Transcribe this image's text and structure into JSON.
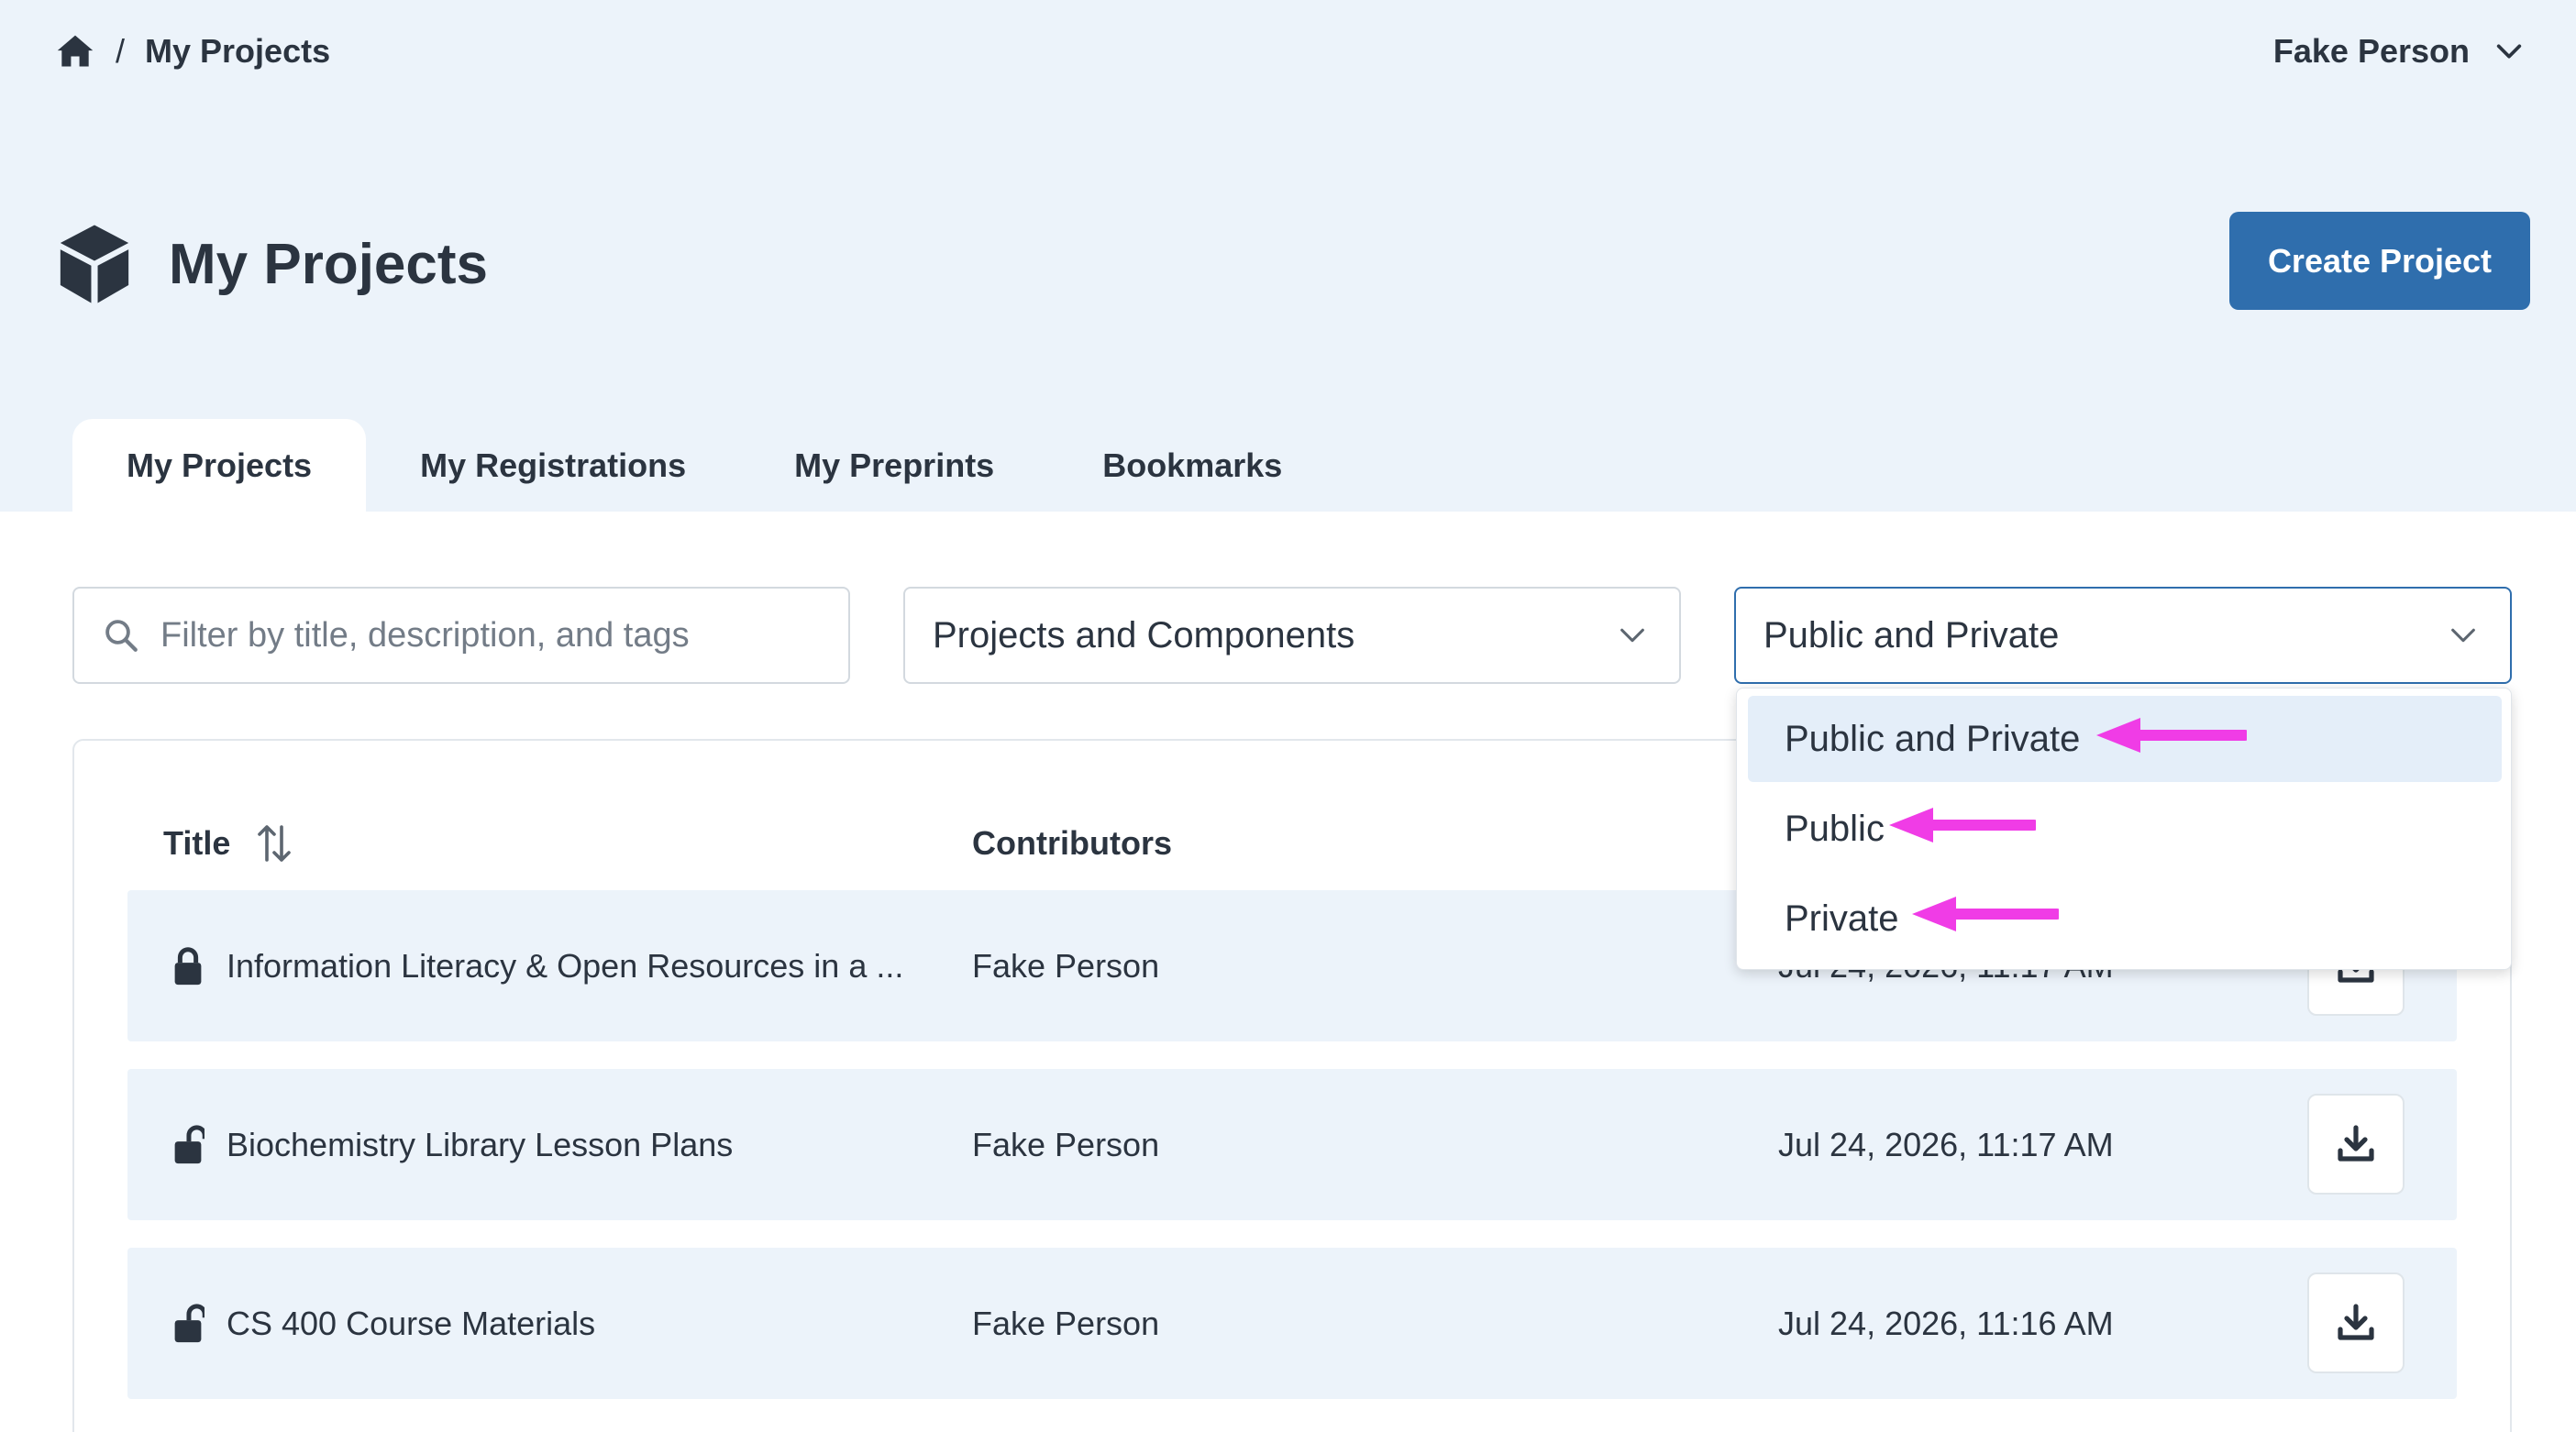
{
  "breadcrumb": {
    "home_icon": "home-icon",
    "separator": "/",
    "current": "My Projects"
  },
  "user_menu": {
    "name": "Fake Person",
    "icon": "chevron-down-icon"
  },
  "page": {
    "icon": "cube-icon",
    "title": "My Projects",
    "create_button": "Create Project"
  },
  "tabs": [
    {
      "label": "My Projects",
      "active": true
    },
    {
      "label": "My Registrations",
      "active": false
    },
    {
      "label": "My Preprints",
      "active": false
    },
    {
      "label": "Bookmarks",
      "active": false
    }
  ],
  "filters": {
    "search_placeholder": "Filter by title, description, and tags",
    "search_value": "",
    "type_select": "Projects and Components",
    "visibility_select": "Public and Private"
  },
  "visibility_dropdown": {
    "options": [
      "Public and Private",
      "Public",
      "Private"
    ],
    "selected": "Public and Private",
    "annotation_color": "#f03ce6"
  },
  "table": {
    "headers": {
      "title": "Title",
      "contributors": "Contributors"
    },
    "rows": [
      {
        "locked": true,
        "title": "Information Literacy & Open Resources in a ...",
        "contributors": "Fake Person",
        "date": "Jul 24, 2026, 11:17 AM"
      },
      {
        "locked": false,
        "title": "Biochemistry Library Lesson Plans",
        "contributors": "Fake Person",
        "date": "Jul 24, 2026, 11:17 AM"
      },
      {
        "locked": false,
        "title": "CS 400 Course Materials",
        "contributors": "Fake Person",
        "date": "Jul 24, 2026, 11:16 AM"
      }
    ]
  },
  "colors": {
    "header_bg": "#ecf3fa",
    "primary": "#2f6ead",
    "text": "#2b3440",
    "row_bg": "#ecf3fa"
  }
}
